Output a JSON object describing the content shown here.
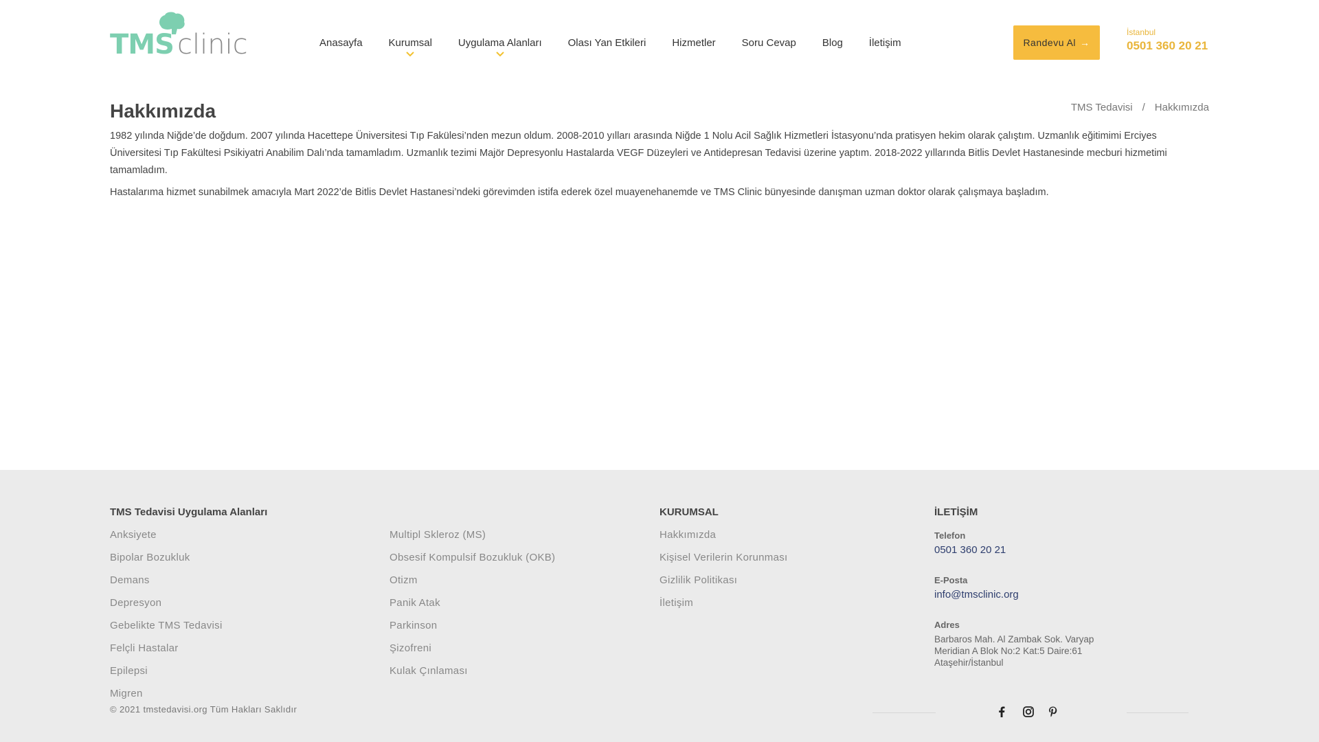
{
  "header": {
    "logo": {
      "tms": "TMS",
      "clinic": "clinic"
    },
    "nav": [
      {
        "label": "Anasayfa",
        "dropdown": false
      },
      {
        "label": "Kurumsal",
        "dropdown": true
      },
      {
        "label": "Uygulama Alanları",
        "dropdown": true
      },
      {
        "label": "Olası Yan Etkileri",
        "dropdown": false
      },
      {
        "label": "Hizmetler",
        "dropdown": false
      },
      {
        "label": "Soru Cevap",
        "dropdown": false
      },
      {
        "label": "Blog",
        "dropdown": false
      },
      {
        "label": "İletişim",
        "dropdown": false
      }
    ],
    "cta_label": "Randevu Al",
    "phone_city": "İstanbul",
    "phone_number": "0501 360 20 21"
  },
  "main": {
    "title": "Hakkımızda",
    "breadcrumb": [
      "TMS Tedavisi",
      "Hakkımızda"
    ],
    "breadcrumb_sep": "/",
    "paragraphs": [
      "1982 yılında Niğde’de doğdum. 2007 yılında Hacettepe Üniversitesi Tıp Fakülesi’nden mezun oldum. 2008-2010 yılları arasında Niğde 1 Nolu Acil Sağlık Hizmetleri İstasyonu’nda pratisyen hekim olarak çalıştım. Uzmanlık eğitimimi Erciyes Üniversitesi Tıp Fakültesi Psikiyatri Anabilim Dalı’nda tamamladım. Uzmanlık tezimi Majör Depresyonlu Hastalarda VEGF Düzeyleri ve Antidepresan Tedavisi üzerine yaptım. 2018-2022 yıllarında Bitlis Devlet Hastanesinde mecburi hizmetimi tamamladım.",
      "Hastalarıma hizmet sunabilmek amacıyla Mart 2022’de Bitlis Devlet Hastanesi’ndeki görevimden istifa ederek özel muayenehanemde ve TMS Clinic bünyesinde danışman uzman doktor olarak çalışmaya başladım."
    ]
  },
  "footer": {
    "areas_title": "TMS Tedavisi Uygulama Alanları",
    "areas_col1": [
      "Anksiyete",
      "Bipolar Bozukluk",
      "Demans",
      "Depresyon",
      "Gebelikte TMS Tedavisi",
      "Felçli Hastalar",
      "Epilepsi",
      "Migren"
    ],
    "areas_col2": [
      "Multipl Skleroz (MS)",
      "Obsesif Kompulsif Bozukluk (OKB)",
      "Otizm",
      "Panik Atak",
      "Parkinson",
      "Şizofreni",
      "Kulak Çınlaması"
    ],
    "corporate_title": "KURUMSAL",
    "corporate_links": [
      "Hakkımızda",
      "Kişisel Verilerin Korunması",
      "Gizlilik Politikası",
      "İletişim"
    ],
    "contact_title": "İLETİŞİM",
    "phone_label": "Telefon",
    "phone_value": "0501 360 20 21",
    "email_label": "E-Posta",
    "email_value": "info@tmsclinic.org",
    "address_label": "Adres",
    "address_value": "Barbaros Mah. Al Zambak Sok. Varyap Meridian A Blok No:2 Kat:5 Daire:61 Ataşehir/İstanbul",
    "copyright": "© 2021 tmstedavisi.org Tüm Hakları Saklıdır",
    "social_icons": [
      "facebook-icon",
      "instagram-icon",
      "pinterest-icon"
    ]
  },
  "colors": {
    "brand_green": "#7dcfb0",
    "accent_yellow": "#f6bc3e",
    "phone_yellow": "#e9b53a",
    "footer_bg": "#ebebeb",
    "link_blue": "#2e3e6e"
  }
}
